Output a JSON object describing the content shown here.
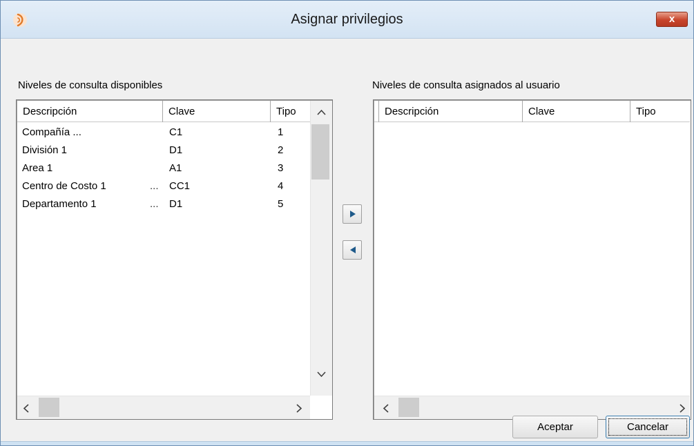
{
  "window": {
    "title": "Asignar privilegios",
    "close_label": "x"
  },
  "available": {
    "label": "Niveles de consulta disponibles",
    "columns": [
      "Descripción",
      "Clave",
      "Tipo"
    ],
    "rows": [
      {
        "descripcion": "Compañía ...",
        "ellipsis": "",
        "clave": "C1",
        "tipo": "1"
      },
      {
        "descripcion": "División 1",
        "ellipsis": "",
        "clave": "D1",
        "tipo": "2"
      },
      {
        "descripcion": "Area 1",
        "ellipsis": "",
        "clave": "A1",
        "tipo": "3"
      },
      {
        "descripcion": "Centro de Costo 1",
        "ellipsis": "...",
        "clave": "CC1",
        "tipo": "4"
      },
      {
        "descripcion": "Departamento 1",
        "ellipsis": "...",
        "clave": "D1",
        "tipo": "5"
      }
    ]
  },
  "assigned": {
    "label": "Niveles de consulta asignados al usuario",
    "columns": [
      "Descripción",
      "Clave",
      "Tipo"
    ],
    "rows": []
  },
  "buttons": {
    "accept": "Aceptar",
    "cancel": "Cancelar"
  },
  "icons": {
    "app": "app-logo-icon",
    "add": "triangle-right-icon",
    "remove": "triangle-left-icon"
  },
  "colors": {
    "titlebar": "#dbe8f5",
    "close": "#c8452c",
    "move_arrow": "#1e5a8a"
  }
}
